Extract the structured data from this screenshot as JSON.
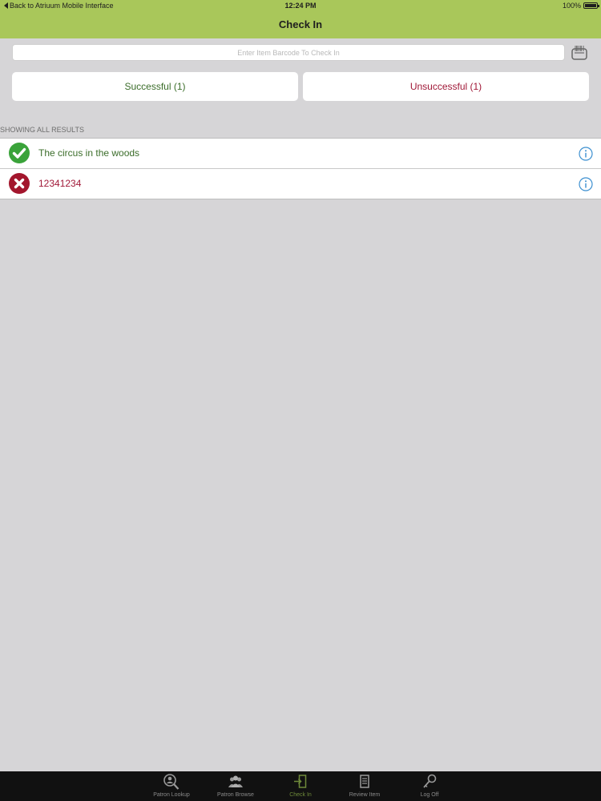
{
  "status_bar": {
    "back_label": "Back to Atriuum Mobile Interface",
    "time": "12:24 PM",
    "battery": "100%"
  },
  "header": {
    "title": "Check In"
  },
  "barcode": {
    "placeholder": "Enter Item Barcode To Check In",
    "value": ""
  },
  "segments": {
    "successful": "Successful (1)",
    "unsuccessful": "Unsuccessful (1)"
  },
  "results": {
    "heading": "SHOWING ALL RESULTS",
    "items": [
      {
        "text": "The circus in the woods",
        "status": "success",
        "icon": "check-icon"
      },
      {
        "text": "12341234",
        "status": "failure",
        "icon": "x-icon"
      }
    ]
  },
  "tabs": [
    {
      "label": "Patron Lookup",
      "icon": "magnifier-person-icon"
    },
    {
      "label": "Patron Browse",
      "icon": "people-icon"
    },
    {
      "label": "Check In",
      "icon": "check-in-icon",
      "active": true
    },
    {
      "label": "Review Item",
      "icon": "document-icon"
    },
    {
      "label": "Log Off",
      "icon": "key-icon"
    }
  ],
  "colors": {
    "header": "#a9c75a",
    "success": "#3b6d2a",
    "failure": "#a01837",
    "info": "#3b8fd0",
    "background": "#d6d5d7",
    "tabbar": "#111111"
  }
}
